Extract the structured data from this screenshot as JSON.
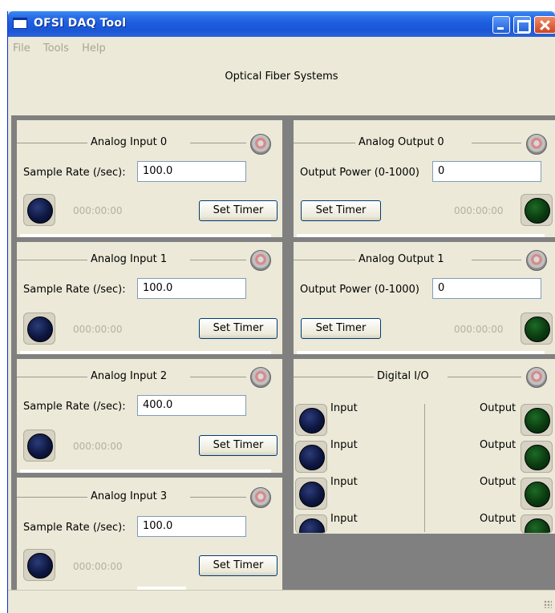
{
  "window": {
    "title": "OFSI DAQ Tool",
    "icon": "app-window-icon",
    "controls": [
      "minimize-icon",
      "maximize-icon",
      "close-icon"
    ]
  },
  "menu": {
    "file": "File",
    "tools": "Tools",
    "help": "Help"
  },
  "header": {
    "title": "Optical Fiber Systems"
  },
  "analog_inputs": [
    {
      "title": "Analog Input 0",
      "rate_label": "Sample Rate (/sec):",
      "rate_value": "100.0",
      "timer": "000:00:00",
      "button": "Set Timer"
    },
    {
      "title": "Analog Input 1",
      "rate_label": "Sample Rate (/sec):",
      "rate_value": "100.0",
      "timer": "000:00:00",
      "button": "Set Timer"
    },
    {
      "title": "Analog Input 2",
      "rate_label": "Sample Rate (/sec):",
      "rate_value": "400.0",
      "timer": "000:00:00",
      "button": "Set Timer"
    },
    {
      "title": "Analog Input 3",
      "rate_label": "Sample Rate (/sec):",
      "rate_value": "100.0",
      "timer": "000:00:00",
      "button": "Set Timer"
    }
  ],
  "analog_outputs": [
    {
      "title": "Analog Output 0",
      "power_label": "Output Power (0-1000)",
      "power_value": "0",
      "timer": "000:00:00",
      "button": "Set Timer"
    },
    {
      "title": "Analog Output 1",
      "power_label": "Output Power (0-1000)",
      "power_value": "0",
      "timer": "000:00:00",
      "button": "Set Timer"
    }
  ],
  "digital_io": {
    "title": "Digital I/O",
    "inputs": [
      "Input",
      "Input",
      "Input",
      "Input"
    ],
    "outputs": [
      "Output",
      "Output",
      "Output",
      "Output"
    ]
  },
  "colors": {
    "titlebar": "#1d5ee0",
    "led_input": "#0d1640",
    "led_output": "#0a3a10",
    "window_bg": "#ece9d8",
    "workarea_bg": "#808080"
  }
}
